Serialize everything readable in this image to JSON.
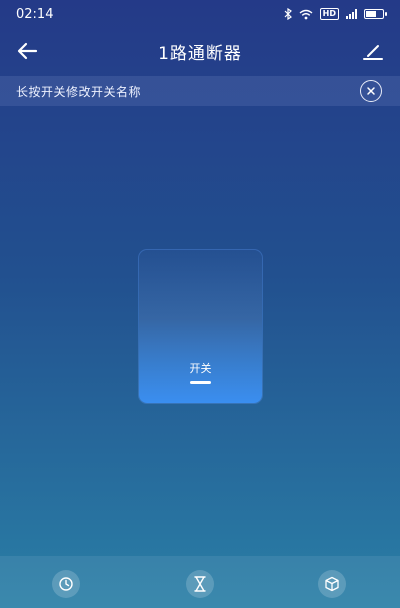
{
  "status_bar": {
    "time": "02:14"
  },
  "header": {
    "title": "1路通断器"
  },
  "notice": {
    "text": "长按开关修改开关名称"
  },
  "switch": {
    "label": "开关"
  },
  "bottom_tabs": [
    {
      "icon": "clock-icon"
    },
    {
      "icon": "hourglass-icon"
    },
    {
      "icon": "cube-icon"
    }
  ]
}
